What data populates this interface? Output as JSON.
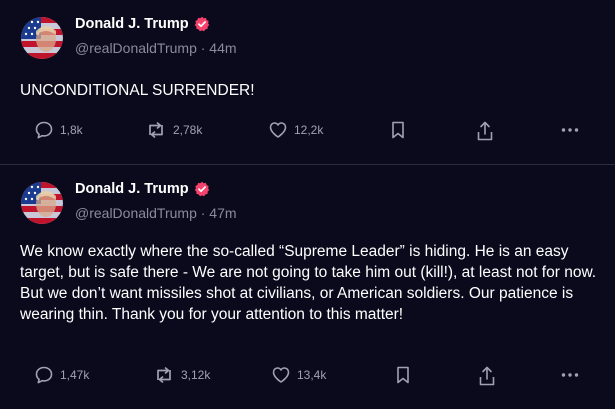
{
  "posts": [
    {
      "author": "Donald J. Trump",
      "meta": "@realDonaldTrump · 44m",
      "text": "UNCONDITIONAL SURRENDER!",
      "replies": "1,8k",
      "reposts": "2,78k",
      "likes": "12,2k"
    },
    {
      "author": "Donald J. Trump",
      "meta": "@realDonaldTrump · 47m",
      "text": "We know exactly where the so-called “Supreme Leader” is hiding. He is an easy target, but is safe there - We are not going to take him out (kill!), at least not for now. But we don’t want missiles shot at civilians, or American soldiers. Our patience is wearing thin. Thank you for your attention to this matter!",
      "replies": "1,47k",
      "reposts": "3,12k",
      "likes": "13,4k"
    }
  ],
  "colors": {
    "background": "#0b0a1d",
    "muted_text": "#8b8a9c",
    "icon": "#a2a1b3",
    "verified_badge": "#f5426c",
    "divider": "#2b2a3e"
  },
  "icons": {
    "reply": "reply-icon",
    "repost": "repost-icon",
    "like": "heart-icon",
    "bookmark": "bookmark-icon",
    "share": "share-icon",
    "more": "more-icon",
    "verified": "verified-badge-icon"
  }
}
